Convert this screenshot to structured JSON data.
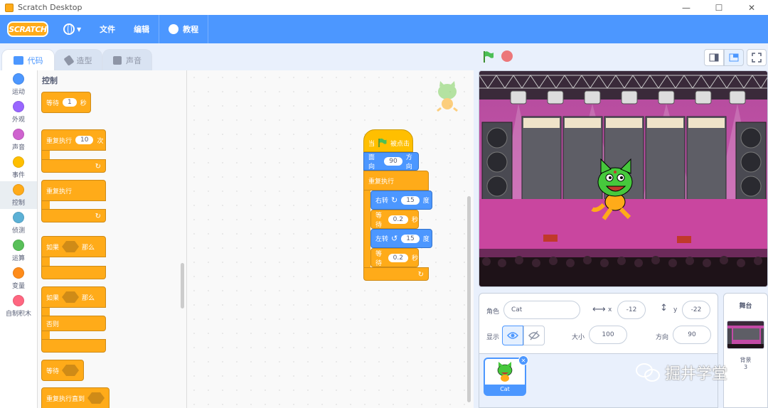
{
  "window": {
    "title": "Scratch Desktop",
    "minimize": "—",
    "maximize": "☐",
    "close": "✕"
  },
  "menubar": {
    "logo": "SCRATCH",
    "file": "文件",
    "edit": "编辑",
    "tutorials": "教程"
  },
  "tabs": {
    "code": "代码",
    "costumes": "造型",
    "sounds": "声音"
  },
  "categories": [
    {
      "label": "运动",
      "color": "#4c97ff"
    },
    {
      "label": "外观",
      "color": "#9966ff"
    },
    {
      "label": "声音",
      "color": "#cf63cf"
    },
    {
      "label": "事件",
      "color": "#ffbf00"
    },
    {
      "label": "控制",
      "color": "#ffab19"
    },
    {
      "label": "侦测",
      "color": "#5cb1d6"
    },
    {
      "label": "运算",
      "color": "#59c059"
    },
    {
      "label": "变量",
      "color": "#ff8c1a"
    },
    {
      "label": "自制积木",
      "color": "#ff6680"
    }
  ],
  "palette": {
    "heading": "控制",
    "wait": {
      "pre": "等待",
      "val": "1",
      "post": "秒"
    },
    "repeat": {
      "pre": "重复执行",
      "val": "10",
      "post": "次"
    },
    "forever": "重复执行",
    "if_then": {
      "pre": "如果",
      "post": "那么"
    },
    "if_else": {
      "pre": "如果",
      "post": "那么",
      "else": "否则"
    },
    "wait_until": "等待",
    "repeat_until": "重复执行直到"
  },
  "script": {
    "hat": {
      "pre": "当",
      "post": "被点击"
    },
    "point": {
      "pre": "面向",
      "val": "90",
      "post": "方向"
    },
    "forever": "重复执行",
    "turn_right": {
      "pre": "右转",
      "val": "15",
      "post": "度"
    },
    "wait1": {
      "pre": "等待",
      "val": "0.2",
      "post": "秒"
    },
    "turn_left": {
      "pre": "左转",
      "val": "15",
      "post": "度"
    },
    "wait2": {
      "pre": "等待",
      "val": "0.2",
      "post": "秒"
    }
  },
  "sprite_info": {
    "sprite_label": "角色",
    "sprite_name": "Cat",
    "x_label": "x",
    "x": "-12",
    "y_label": "y",
    "y": "-22",
    "show_label": "显示",
    "size_label": "大小",
    "size": "100",
    "direction_label": "方向",
    "direction": "90"
  },
  "sprite_list": {
    "tile_name": "Cat",
    "delete": "✕"
  },
  "stage_pane": {
    "header": "舞台",
    "backdrops_label": "背景",
    "backdrops_count": "3"
  },
  "watermark": "掘井学堂",
  "colors": {
    "accent": "#4c97ff",
    "control": "#ffab19",
    "events": "#ffbf00",
    "motion": "#4c97ff"
  }
}
